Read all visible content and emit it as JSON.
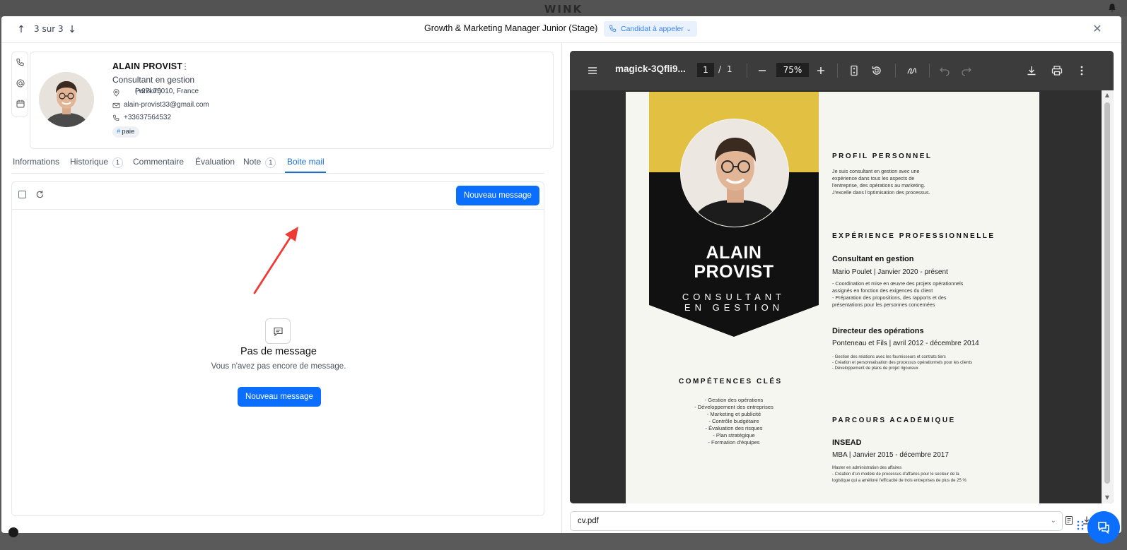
{
  "app": {
    "brand": "WINK"
  },
  "header": {
    "counter": "3 sur 3",
    "job_title": "Growth & Marketing Manager Junior (Stage)",
    "status": "Candidat à appeler"
  },
  "candidate": {
    "name": "ALAIN PROVIST",
    "title": "Consultant en gestion",
    "location": "Paris 75010, France",
    "distance": "(+27km)",
    "email": "alain-provist33@gmail.com",
    "phone": "+33637564532",
    "tag": "paie"
  },
  "tabs": [
    {
      "label": "Informations"
    },
    {
      "label": "Historique",
      "count": "1"
    },
    {
      "label": "Commentaire"
    },
    {
      "label": "Évaluation"
    },
    {
      "label": "Note",
      "count": "1"
    },
    {
      "label": "Boite mail"
    }
  ],
  "mailbox": {
    "new_message": "Nouveau message",
    "empty_title": "Pas de message",
    "empty_subtitle": "Vous n'avez pas encore de message.",
    "empty_button": "Nouveau message"
  },
  "pdf_viewer": {
    "file_name": "magick-3Qfli9...",
    "page": "1",
    "separator": "/",
    "total_pages": "1",
    "zoom": "75%"
  },
  "cv": {
    "name_line1": "ALAIN",
    "name_line2": "PROVIST",
    "role_line1": "CONSULTANT",
    "role_line2": "EN GESTION",
    "profile_heading": "PROFIL PERSONNEL",
    "profile_text": [
      "Je suis consultant en gestion avec une",
      "expérience dans tous les aspects de",
      "l'entreprise, des opérations au marketing.",
      "J'excelle dans l'optimisation des processus."
    ],
    "experience_heading": "EXPÉRIENCE PROFESSIONNELLE",
    "job1_title": "Consultant en gestion",
    "job1_meta": "Mario Poulet | Janvier 2020 - présent",
    "job1_lines": [
      "- Coordination et mise en œuvre des projets opérationnels",
      "assignés en fonction des exigences du client",
      "- Préparation des propositions, des rapports et des",
      "présentations pour les personnes concernées"
    ],
    "job2_title": "Directeur des opérations",
    "job2_meta": "Ponteneau et Fils | avril 2012 - décembre 2014",
    "job2_lines": [
      "- Gestion des relations avec les fournisseurs et contrats tiers",
      "- Création et personnalisation des processus opérationnels pour les clients",
      "- Développement de plans de projet rigoureux"
    ],
    "skills_heading": "COMPÉTENCES CLÉS",
    "skills": [
      "- Gestion des opérations",
      "- Développement des entreprises",
      "- Marketing et publicité",
      "- Contrôle budgétaire",
      "- Évaluation des risques",
      "- Plan stratégique",
      "- Formation d'équipes"
    ],
    "education_heading": "PARCOURS ACADÉMIQUE",
    "school": "INSEAD",
    "degree_meta": "MBA | Janvier 2015 - décembre 2017",
    "edu_lines": [
      "Master en administration des affaires",
      "- Création d'un modèle de processus d'affaires pour le secteur de la",
      "logistique qui a amélioré l'efficacité de trois entreprises de plus de 25 %"
    ]
  },
  "file_select": {
    "value": "cv.pdf"
  },
  "colors": {
    "primary": "#0b6efd",
    "active_tab": "#1d6fd6",
    "cv_yellow": "#e2c041",
    "cv_black": "#111111"
  }
}
